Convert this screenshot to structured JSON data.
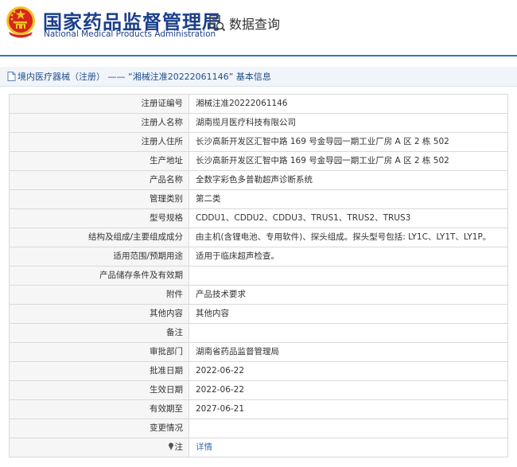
{
  "header": {
    "title_cn": "国家药品监督管理局",
    "title_en": "National Medical Products Administration",
    "query_label": "数据查询",
    "emblem_icon": "national-emblem-icon"
  },
  "breadcrumb": {
    "text": "境内医疗器械（注册） —— “湘械注准20222061146” 基本信息"
  },
  "rows": [
    {
      "label": "注册证编号",
      "value": "湘械注准20222061146"
    },
    {
      "label": "注册人名称",
      "value": "湖南揽月医疗科技有限公司"
    },
    {
      "label": "注册人住所",
      "value": "长沙高新开发区汇智中路 169 号金导园一期工业厂房 A 区 2 栋 502"
    },
    {
      "label": "生产地址",
      "value": "长沙高新开发区汇智中路 169 号金导园一期工业厂房 A 区 2 栋 502"
    },
    {
      "label": "产品名称",
      "value": "全数字彩色多普勒超声诊断系统"
    },
    {
      "label": "管理类别",
      "value": "第二类"
    },
    {
      "label": "型号规格",
      "value": "CDDU1、CDDU2、CDDU3、TRUS1、TRUS2、TRUS3"
    },
    {
      "label": "结构及组成/主要组成成分",
      "value": "由主机(含锂电池、专用软件)、探头组成。探头型号包括: LY1C、LY1T、LY1P。"
    },
    {
      "label": "适用范围/预期用途",
      "value": "适用于临床超声检查。"
    },
    {
      "label": "产品储存条件及有效期",
      "value": ""
    },
    {
      "label": "附件",
      "value": "产品技术要求"
    },
    {
      "label": "其他内容",
      "value": "其他内容"
    },
    {
      "label": "备注",
      "value": ""
    },
    {
      "label": "审批部门",
      "value": "湖南省药品监督管理局"
    },
    {
      "label": "批准日期",
      "value": "2022-06-22"
    },
    {
      "label": "生效日期",
      "value": "2022-06-22"
    },
    {
      "label": "有效期至",
      "value": "2027-06-21"
    },
    {
      "label": "变更情况",
      "value": ""
    }
  ],
  "note_row": {
    "label": "注",
    "link": "详情"
  },
  "colors": {
    "brand_blue": "#1b3f8b",
    "divider": "#3472c4",
    "link": "#3a6fb5",
    "emblem_red": "#d7261c",
    "emblem_gold": "#f3c323"
  }
}
